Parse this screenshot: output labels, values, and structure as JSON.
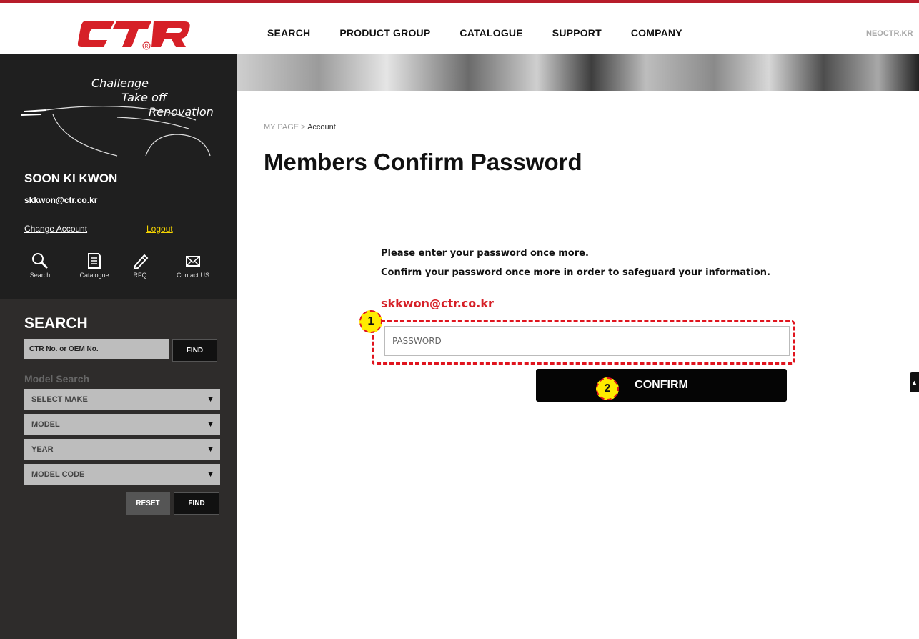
{
  "header": {
    "logo_text": "CTR",
    "nav": [
      "SEARCH",
      "PRODUCT GROUP",
      "CATALOGUE",
      "SUPPORT",
      "COMPANY"
    ],
    "site_link": "NEOCTR.KR"
  },
  "sidebar": {
    "slogan": [
      "Challenge",
      "Take off",
      "Renovation"
    ],
    "user_name": "SOON KI KWON",
    "user_email": "skkwon@ctr.co.kr",
    "change_account": "Change Account",
    "logout": "Logout",
    "quick_links": [
      {
        "label": "Search",
        "icon": "search-icon"
      },
      {
        "label": "Catalogue",
        "icon": "catalogue-icon"
      },
      {
        "label": "RFQ",
        "icon": "pencil-icon"
      },
      {
        "label": "Contact US",
        "icon": "mail-icon"
      }
    ],
    "search": {
      "title": "SEARCH",
      "placeholder": "CTR No. or OEM No.",
      "find": "FIND",
      "model_search_label": "Model Search",
      "selects": [
        "SELECT MAKE",
        "MODEL",
        "YEAR",
        "MODEL CODE"
      ],
      "reset": "RESET",
      "find2": "FIND"
    }
  },
  "main": {
    "breadcrumb": {
      "parent": "MY PAGE",
      "separator": ">",
      "current": "Account"
    },
    "title": "Members Confirm Password",
    "message_1": "Please enter your password once more.",
    "message_2": "Confirm your password once more in order to safeguard your information.",
    "email": "skkwon@ctr.co.kr",
    "password_placeholder": "PASSWORD",
    "confirm": "CONFIRM"
  },
  "annotations": {
    "badge_1": "1",
    "badge_2": "2"
  },
  "colors": {
    "brand_red": "#d62027",
    "accent_yellow": "#f5d400",
    "annotation_red": "#e0141e"
  }
}
